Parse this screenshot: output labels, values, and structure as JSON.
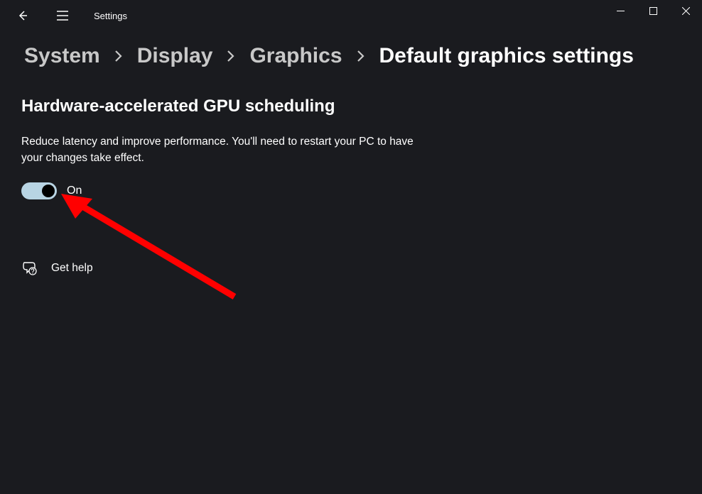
{
  "app": {
    "title": "Settings"
  },
  "breadcrumb": {
    "items": [
      "System",
      "Display",
      "Graphics"
    ],
    "current": "Default graphics settings"
  },
  "section": {
    "heading": "Hardware-accelerated GPU scheduling",
    "description": "Reduce latency and improve performance. You'll need to restart your PC to have your changes take effect.",
    "toggle_state": "On"
  },
  "help": {
    "label": "Get help"
  }
}
